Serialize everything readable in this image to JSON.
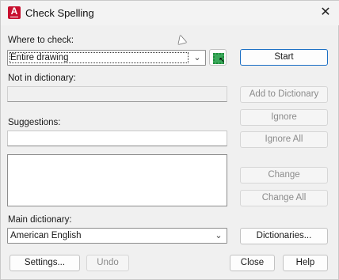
{
  "window": {
    "title": "Check Spelling",
    "close_glyph": "✕",
    "app_icon_letter": "A"
  },
  "where": {
    "label": "Where to check:",
    "value": "Entire drawing"
  },
  "not_in_dictionary": {
    "label": "Not in dictionary:",
    "value": ""
  },
  "suggestions": {
    "label": "Suggestions:",
    "value": "",
    "items": []
  },
  "main_dictionary": {
    "label": "Main dictionary:",
    "value": "American English"
  },
  "buttons": {
    "start": "Start",
    "add_to_dictionary": "Add to Dictionary",
    "ignore": "Ignore",
    "ignore_all": "Ignore All",
    "change": "Change",
    "change_all": "Change All",
    "dictionaries": "Dictionaries...",
    "settings": "Settings...",
    "undo": "Undo",
    "close": "Close",
    "help": "Help"
  },
  "icons": {
    "app": "autocad-app-icon",
    "select_objects": "select-objects-icon",
    "dropdown": "chevron-down-icon",
    "cursor": "mouse-pointer-icon"
  },
  "colors": {
    "app_icon": "#c8102e",
    "default_button_border": "#1b6fc4",
    "select_icon": "#3aa85a"
  }
}
